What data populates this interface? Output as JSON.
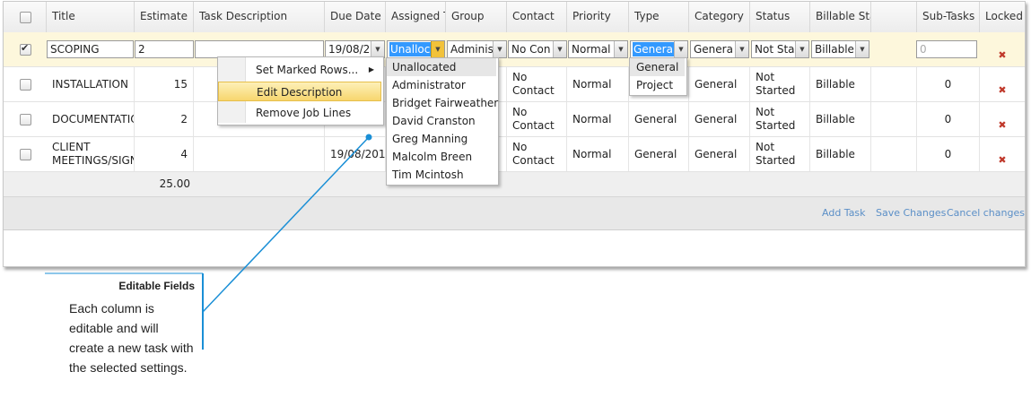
{
  "columns": [
    "Title",
    "Estimate",
    "Task Description",
    "Due Date",
    "Assigned T",
    "Group",
    "Contact",
    "Priority",
    "Type",
    "Category",
    "Status",
    "Billable Sta",
    "Sub-Tasks",
    "Locked"
  ],
  "edit_row": {
    "title": "SCOPING",
    "estimate": "2",
    "description": "",
    "due_date": "19/08/2",
    "assigned": "Unalloc",
    "group": "Adminis",
    "contact": "No Con",
    "priority": "Normal",
    "type": "Genera",
    "category": "Genera",
    "status": "Not Sta",
    "billable": "Billable",
    "subtasks_placeholder": "0"
  },
  "rows": [
    {
      "title": "INSTALLATION",
      "estimate": "15",
      "due": "",
      "assigned": "",
      "group": "",
      "contact": "No Contact",
      "priority": "Normal",
      "type": "",
      "category": "General",
      "status": "Not Started",
      "billable": "Billable",
      "subtasks": "0"
    },
    {
      "title": "DOCUMENTATIO",
      "estimate": "2",
      "due": "",
      "assigned": "",
      "group": "a",
      "contact": "No Contact",
      "priority": "Normal",
      "type": "General",
      "category": "General",
      "status": "Not Started",
      "billable": "Billable",
      "subtasks": "0"
    },
    {
      "title": "CLIENT MEETINGS/SIGN",
      "estimate": "4",
      "due": "19/08/2015",
      "assigned": "",
      "group": "a",
      "contact": "No Contact",
      "priority": "Normal",
      "type": "General",
      "category": "General",
      "status": "Not Started",
      "billable": "Billable",
      "subtasks": "0"
    }
  ],
  "total_estimate": "25.00",
  "footer_links": {
    "add": "Add Task",
    "save": "Save Changes",
    "cancel": "Cancel changes"
  },
  "context_menu": [
    "Set Marked Rows...",
    "Edit Description",
    "Remove Job Lines"
  ],
  "assigned_options": [
    "Unallocated",
    "Administrator",
    "Bridget Fairweather",
    "David Cranston",
    "Greg Manning",
    "Malcolm Breen",
    "Tim Mcintosh"
  ],
  "type_options": [
    "General",
    "Project"
  ],
  "callout": {
    "title": "Editable Fields",
    "text": "Each column is editable and will create a new task with the selected settings."
  },
  "colors": {
    "accent": "#1a8fd6",
    "link": "#5b8fc7",
    "delete": "#c0392b",
    "menu_highlight": "#f7d66e"
  }
}
